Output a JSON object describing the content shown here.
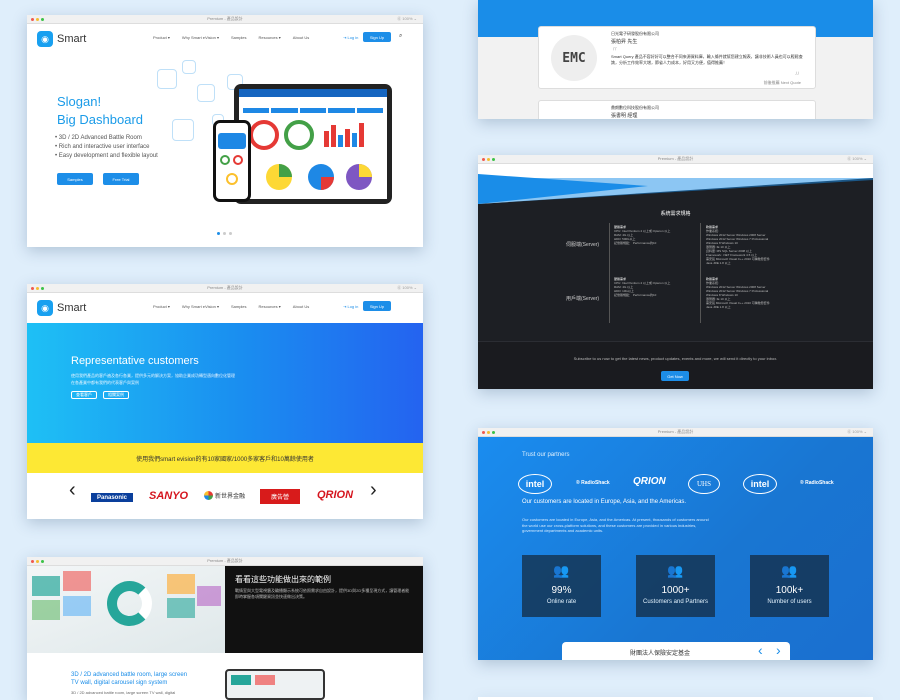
{
  "win1": {
    "chrome_title": "Premium - 產品設計",
    "chrome_right": "⓪ 100% ⌄",
    "logo": "Smart",
    "menu": [
      "Product ▾",
      "Why Smart eVision ▾",
      "Samples",
      "Resources ▾",
      "About Us"
    ],
    "login": "Log in",
    "signup": "Sign Up",
    "slogan": "Slogan!",
    "headline": "Big Dashboard",
    "bullets": [
      "3D / 2D Advanced Battle Room",
      "Rich and interactive user interface",
      "Easy development and flexible layout"
    ],
    "btn_samples": "Samples",
    "btn_trial": "Free Trial"
  },
  "win2": {
    "chrome_title": "Premium - 產品設計",
    "chrome_right": "⓪ 100% ⌄",
    "logo": "Smart",
    "menu": [
      "Product ▾",
      "Why Smart eVision ▾",
      "Samples",
      "Resources ▾",
      "About Us"
    ],
    "login": "Log in",
    "signup": "Sign Up",
    "title": "Representative customers",
    "desc_line1": "使用我們產品的客戶遍及各行各業，提供多元的解決方案，協助企業成功轉型邁向數位化管理",
    "desc_line2": "在各產業中都有我們的代表客戶與案例",
    "btn1": "查看客戶",
    "btn2": "相關案例",
    "banner": "使用我們smart evision的有10家國家/1000多家客戶和10萬餘使用者",
    "brands": [
      "Panasonic",
      "SANYO",
      "新世界金融",
      "廣告營",
      "QRION"
    ],
    "prev": "‹",
    "next": "›"
  },
  "win3": {
    "chrome_title": "Premium - 產品設計",
    "heading": "看看這些功能做出來的範例",
    "body": "戰情室與大型電視牆及輪播顯示系統可依照需求自由設計，提供3D與2D多種呈現方式，讓管理者能即時掌握各項關鍵資訊並快速做出決策。",
    "sub_title_line1": "3D / 2D advanced battle room, large screen",
    "sub_title_line2": "TV wall, digital carousel sign system",
    "sub_desc": "3D / 2D advanced battle room, large screen TV wall, digital"
  },
  "win4": {
    "company1": "日光電子研發股份有限公司",
    "name1": "張柏昇  先生",
    "quote_mark": "「「",
    "quote": "Smart Query 產品不容好好可以整合不同來源資料庫，輸入條件就幫您建立報表，讓非技術人員也可以輕鬆查詢，分析工作效率大增，節省人力成本，好用又方便，值得推薦！",
    "quote_end": "」」",
    "pager": "前後推薦  Next Quote",
    "logo": "EMC",
    "company2": "鼎朗數位科技股份有限公司",
    "name2": "張書明  經理"
  },
  "win5": {
    "chrome_title": "Premium - 產品設計",
    "chrome_right": "⓪ 100% ⌄",
    "title": "系統需求規格",
    "server_label": "伺服端(Server)",
    "client_label": "用戶端(Server)",
    "server_hw_title": "硬體需求",
    "server_hw_lines": [
      "CPU: Intel Pentium 4 以上或 Opteron 以上",
      "RAM: 4G 以上",
      "HDD: 500G以上",
      "記憶體規範：  Performance約10"
    ],
    "server_sw_title": "軟體需求",
    "server_sw_lines": [
      "作業系統:",
      "Windows 2012 Server   Windows 2008 Server",
      "Windows 2012 Server   Windows 7 Professional",
      "Windows 8   Windows 10",
      "瀏覽器: IE 10 以上",
      "資料庫: MS SQL Server 2008 以上",
      "Framework: .NET Framework 4.5 以上",
      "需安裝 Microsoft Visual C++ 2010 可轉散發套件",
      "Java JRE 1.8 以上"
    ],
    "client_hw_title": "硬體需求",
    "client_hw_lines": [
      "CPU: Intel Pentium 4 以上或 Opteron 以上",
      "RAM: 4G 以上",
      "HDD: 10G以上",
      "記憶體規範：  Performance約10"
    ],
    "client_sw_title": "軟體需求",
    "client_sw_lines": [
      "作業系統:",
      "Windows 2012 Server   Windows 2008 Server",
      "Windows 2012 Server   Windows 7 Professional",
      "Windows 8   Windows 10",
      "瀏覽器: IE 10 以上",
      "需安裝 Microsoft Visual C++ 2010 可轉散發套件",
      "Java JRE 1.8 以上"
    ],
    "subscribe": "Subscribe to us now to get the latest news, product updates, events and more, we will send it directly to your inbox.",
    "subscribe_btn": "Get Now"
  },
  "win6": {
    "chrome_title": "Premium - 產品設計",
    "chrome_right": "⓪ 100% ⌄",
    "trust": "Trust our partners",
    "partners": [
      "intel",
      "RadioShack",
      "QRION",
      "UHS",
      "intel",
      "RadioShack"
    ],
    "located": "Our customers are located in Europe, Asia, and the Americas.",
    "desc": "Our customers are located in Europe, Asia, and the Americas. At present, thousands of customers around the world use our cross-platform solutions, and these customers are provided in various industries, government departments and academic units.",
    "stats": [
      {
        "value": "99%",
        "label": "Online rate"
      },
      {
        "value": "1000+",
        "label": "Customers and Partners"
      },
      {
        "value": "100k+",
        "label": "Number of users"
      }
    ],
    "footer_text": "財團法人保險安定基金",
    "prev": "‹",
    "next": "›"
  }
}
